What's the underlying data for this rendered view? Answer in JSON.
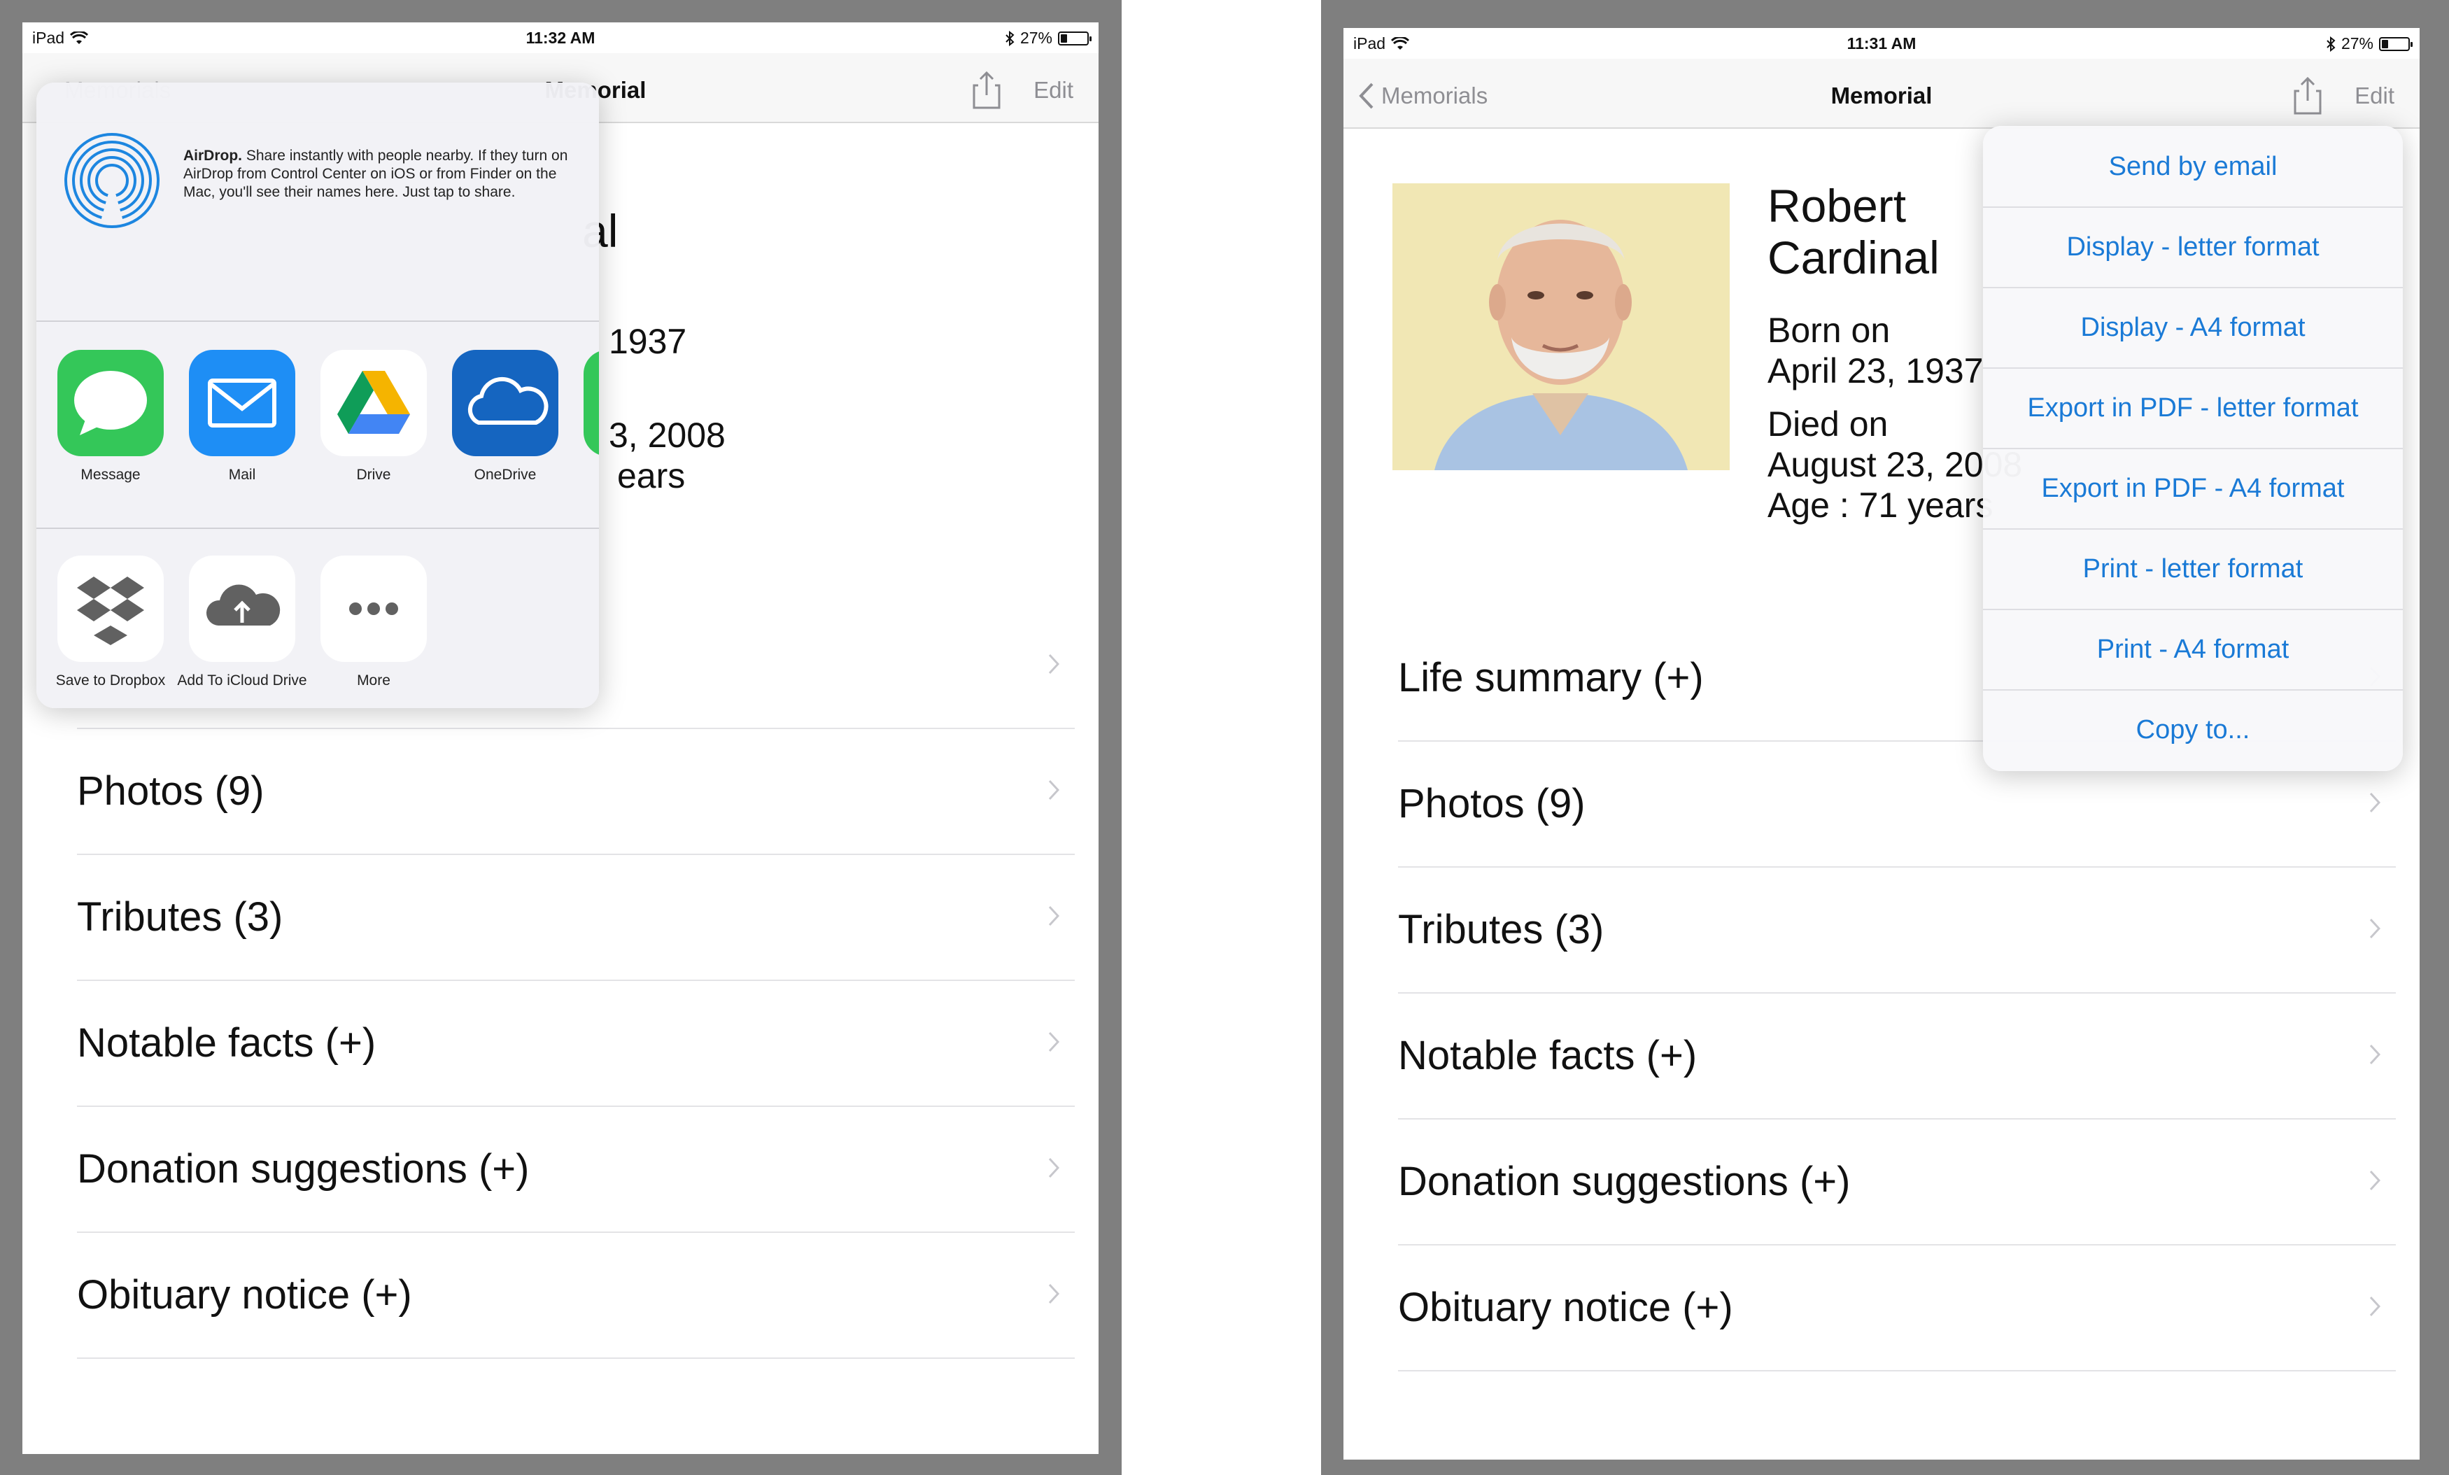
{
  "left": {
    "status": {
      "device": "iPad",
      "time": "11:32 AM",
      "battery": "27%",
      "battery_level": 0.27
    },
    "nav": {
      "back": "Memorials",
      "title": "Memorial",
      "edit": "Edit"
    },
    "peek": {
      "name_tail": "al",
      "born_tail": "1937",
      "died_tail": "3, 2008",
      "age_tail": "ears"
    },
    "rows": [
      {
        "label": ""
      },
      {
        "label": "Photos (9)"
      },
      {
        "label": "Tributes (3)"
      },
      {
        "label": "Notable facts (+)"
      },
      {
        "label": "Donation suggestions (+)"
      },
      {
        "label": "Obituary notice (+)"
      }
    ],
    "share_sheet": {
      "airdrop_title": "AirDrop.",
      "airdrop_text": "Share instantly with people nearby. If they turn on AirDrop from Control Center on iOS or from Finder on the Mac, you'll see their names here. Just tap to share.",
      "apps": [
        {
          "label": "Message",
          "icon": "messages-icon",
          "color": "#34c759"
        },
        {
          "label": "Mail",
          "icon": "mail-icon",
          "color": "#1e8ef5"
        },
        {
          "label": "Drive",
          "icon": "google-drive-icon",
          "color": "#ffffff"
        },
        {
          "label": "OneDrive",
          "icon": "onedrive-icon",
          "color": "#1565c0"
        }
      ],
      "actions": [
        {
          "label": "Save to Dropbox",
          "icon": "dropbox-icon"
        },
        {
          "label": "Add To iCloud Drive",
          "icon": "icloud-upload-icon"
        },
        {
          "label": "More",
          "icon": "more-icon"
        }
      ]
    }
  },
  "right": {
    "status": {
      "device": "iPad",
      "time": "11:31 AM",
      "battery": "27%",
      "battery_level": 0.27
    },
    "nav": {
      "back": "Memorials",
      "title": "Memorial",
      "edit": "Edit"
    },
    "profile": {
      "first_name": "Robert",
      "last_name": "Cardinal",
      "born_label": "Born on",
      "born_date": "April 23, 1937",
      "died_label": "Died on",
      "died_date": "August 23, 2008",
      "age": "Age : 71 years"
    },
    "rows": [
      {
        "label": "Life summary (+)"
      },
      {
        "label": "Photos (9)"
      },
      {
        "label": "Tributes (3)"
      },
      {
        "label": "Notable facts (+)"
      },
      {
        "label": "Donation suggestions (+)"
      },
      {
        "label": "Obituary notice (+)"
      }
    ],
    "menu": [
      "Send by email",
      "Display - letter format",
      "Display - A4 format",
      "Export in PDF - letter format",
      "Export in PDF - A4 format",
      "Print - letter format",
      "Print - A4 format",
      "Copy to..."
    ]
  }
}
